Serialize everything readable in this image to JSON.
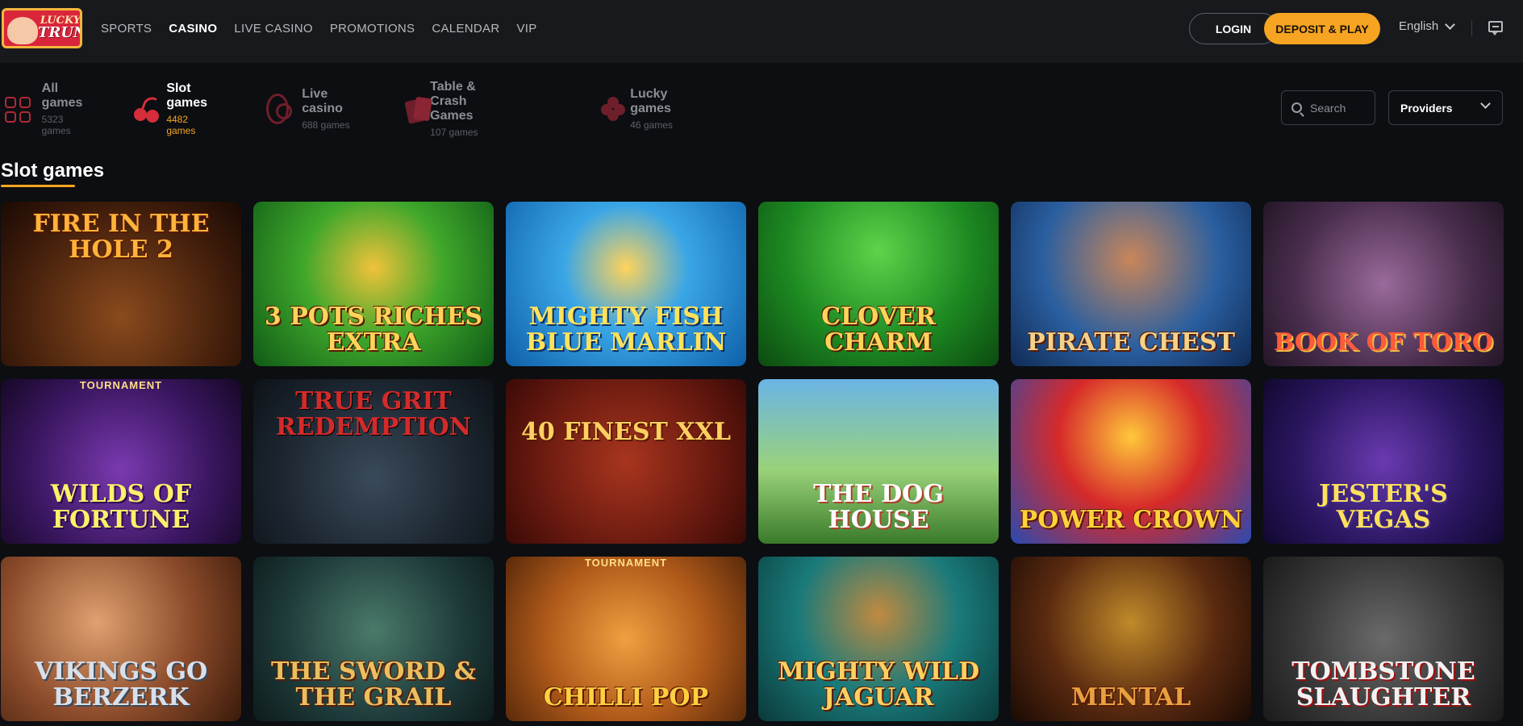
{
  "header": {
    "logo_line1": "LUCKY",
    "logo_line2": "TRUNK",
    "nav": [
      "SPORTS",
      "CASINO",
      "LIVE CASINO",
      "PROMOTIONS",
      "CALENDAR",
      "VIP"
    ],
    "active_nav": "CASINO",
    "login_label": "LOGIN",
    "deposit_label": "DEPOSIT & PLAY",
    "language": "English"
  },
  "categories": [
    {
      "title": "All games",
      "count": "5323 games",
      "icon": "grid-icon"
    },
    {
      "title": "Slot games",
      "count": "4482 games",
      "icon": "cherry-icon"
    },
    {
      "title": "Live casino",
      "count": "688 games",
      "icon": "chip-icon"
    },
    {
      "title": "Table & Crash Games",
      "count": "107 games",
      "icon": "cards-icon"
    },
    {
      "title": "Lucky games",
      "count": "46 games",
      "icon": "clover-icon"
    }
  ],
  "active_category": "Slot games",
  "search": {
    "placeholder": "Search"
  },
  "providers_label": "Providers",
  "section_title": "Slot games",
  "games": [
    {
      "name": "FIRE IN THE HOLE 2",
      "badge": ""
    },
    {
      "name": "3 POTS RICHES EXTRA",
      "badge": ""
    },
    {
      "name": "MIGHTY FISH BLUE MARLIN",
      "badge": ""
    },
    {
      "name": "CLOVER CHARM",
      "badge": ""
    },
    {
      "name": "PIRATE CHEST",
      "badge": ""
    },
    {
      "name": "BOOK OF TORO",
      "badge": ""
    },
    {
      "name": "WILDS OF FORTUNE",
      "badge": "TOURNAMENT"
    },
    {
      "name": "TRUE GRIT REDEMPTION",
      "badge": ""
    },
    {
      "name": "40 FINEST XXL",
      "badge": ""
    },
    {
      "name": "THE DOG HOUSE",
      "badge": ""
    },
    {
      "name": "POWER CROWN",
      "badge": ""
    },
    {
      "name": "JESTER'S VEGAS",
      "badge": ""
    },
    {
      "name": "VIKINGS GO BERZERK",
      "badge": ""
    },
    {
      "name": "THE SWORD & THE GRAIL",
      "badge": ""
    },
    {
      "name": "CHILLI POP",
      "badge": "TOURNAMENT"
    },
    {
      "name": "MIGHTY WILD JAGUAR",
      "badge": ""
    },
    {
      "name": "MENTAL",
      "badge": ""
    },
    {
      "name": "TOMBSTONE SLAUGHTER",
      "badge": ""
    }
  ]
}
